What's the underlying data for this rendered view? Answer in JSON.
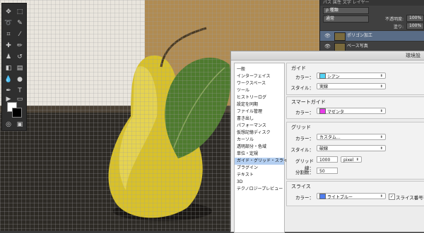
{
  "layers_panel": {
    "tabs": "パス  属性  文字  レイヤー",
    "search_kind": "ρ 種類",
    "blend_mode": "通常",
    "opacity_label": "不透明度:",
    "opacity_value": "100%",
    "fill_label": "塗り:",
    "fill_value": "100%",
    "layers": [
      {
        "name": "ポリゴン加工",
        "selected": true
      },
      {
        "name": "ベース写真",
        "selected": false
      }
    ]
  },
  "prefs": {
    "title": "環境設",
    "categories": [
      "一般",
      "インターフェイス",
      "ワークスペース",
      "ツール",
      "ヒストリーログ",
      "設定を同期",
      "ファイル管理",
      "書き出し",
      "パフォーマンス",
      "仮想記憶ディスク",
      "カーソル",
      "透明部分・色域",
      "単位・定規",
      "ガイド・グリッド・スライス",
      "プラグイン",
      "テキスト",
      "3D",
      "テクノロジープレビュー"
    ],
    "selected_category": "ガイド・グリッド・スライス",
    "guide": {
      "title": "ガイド",
      "color_label": "カラー：",
      "color_value": "シアン",
      "color_hex": "#52d3f5",
      "style_label": "スタイル：",
      "style_value": "実線"
    },
    "smart_guide": {
      "title": "スマートガイド",
      "color_label": "カラー：",
      "color_value": "マゼンタ",
      "color_hex": "#e83ce8"
    },
    "grid": {
      "title": "グリッド",
      "color_label": "カラー：",
      "color_value": "カスタム...",
      "style_label": "スタイル：",
      "style_value": "破線",
      "spacing_label": "グリッド線：",
      "spacing_value": "1000",
      "unit_value": "pixel",
      "subdiv_label": "分割数：",
      "subdiv_value": "50"
    },
    "slice": {
      "title": "スライス",
      "color_label": "カラー：",
      "color_value": "ライトブルー",
      "color_hex": "#4f7ef0",
      "show_numbers_label": "スライス番号を表",
      "show_numbers_checked": true
    }
  }
}
